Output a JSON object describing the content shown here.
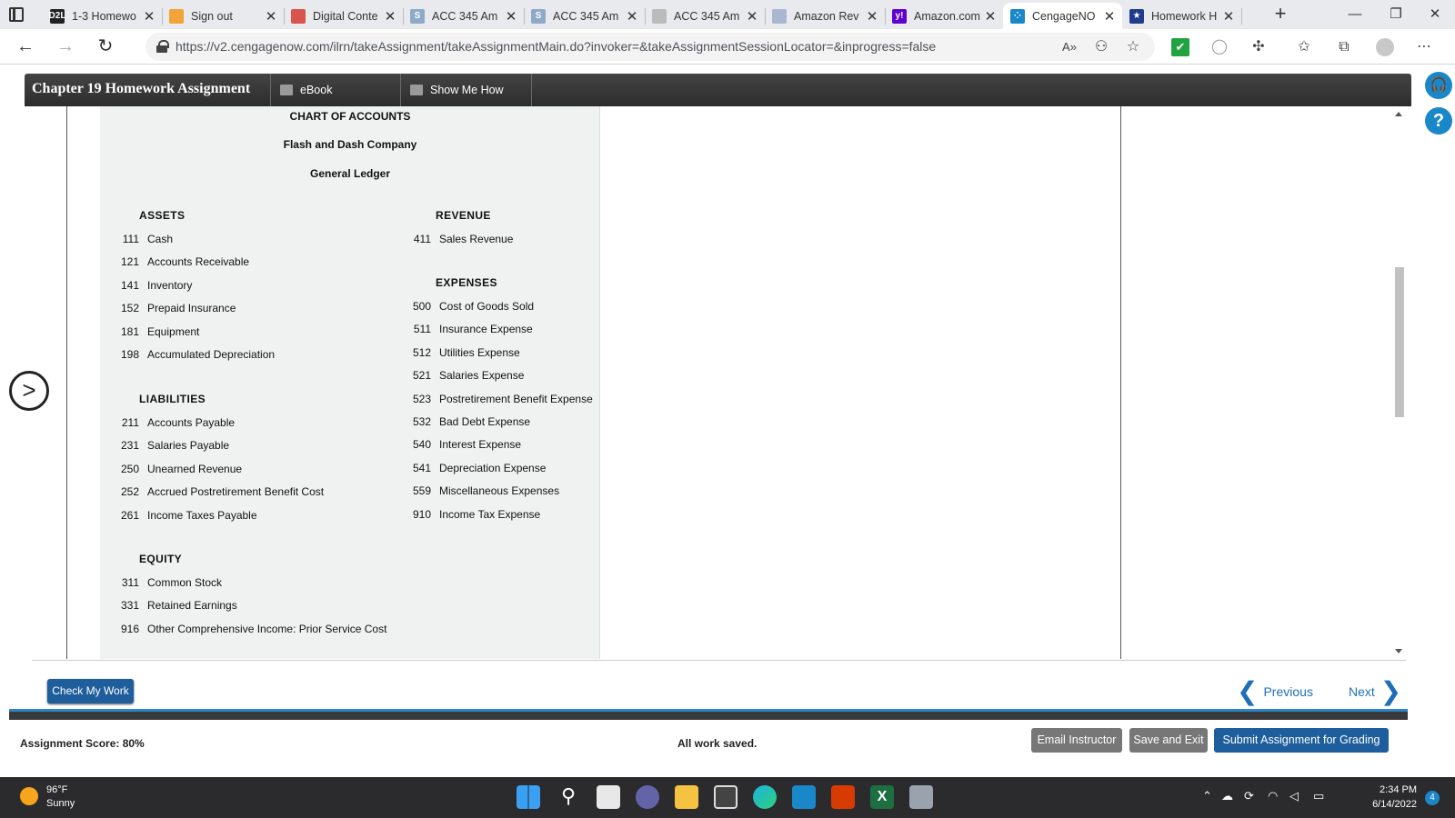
{
  "browser": {
    "tabs": [
      {
        "title": "1-3 Homewo",
        "favicon": "d2l-icon",
        "fav_color": "#222222",
        "fav_text": "D2L"
      },
      {
        "title": "Sign out",
        "favicon": "microsoft-icon",
        "fav_color": "#f2a33a",
        "fav_text": ""
      },
      {
        "title": "Digital Conte",
        "favicon": "book-icon",
        "fav_color": "#d9534f",
        "fav_text": ""
      },
      {
        "title": "ACC 345 Am",
        "favicon": "s-icon",
        "fav_color": "#8fa9c9",
        "fav_text": "S"
      },
      {
        "title": "ACC 345 Am",
        "favicon": "s-icon",
        "fav_color": "#8fa9c9",
        "fav_text": "S"
      },
      {
        "title": "ACC 345 Am",
        "favicon": "document-icon",
        "fav_color": "#bbbbbb",
        "fav_text": ""
      },
      {
        "title": "Amazon Rev",
        "favicon": "chart-icon",
        "fav_color": "#a9b7d0",
        "fav_text": ""
      },
      {
        "title": "Amazon.com",
        "favicon": "yahoo-icon",
        "fav_color": "#6001d2",
        "fav_text": "y!"
      },
      {
        "title": "CengageNO",
        "favicon": "loading-icon",
        "fav_color": "#1a87c9",
        "fav_text": "⁘"
      },
      {
        "title": "Homework H",
        "favicon": "star-badge-icon",
        "fav_color": "#1f3b8c",
        "fav_text": "★"
      }
    ],
    "new_tab_label": "+",
    "url": "https://v2.cengagenow.com/ilrn/takeAssignment/takeAssignmentMain.do?invoker=&takeAssignmentSessionLocator=&inprogress=false"
  },
  "app": {
    "title": "Chapter 19 Homework Assignment",
    "tabs": [
      {
        "label": "eBook"
      },
      {
        "label": "Show Me How"
      }
    ]
  },
  "coa": {
    "heading": "CHART OF ACCOUNTS",
    "company": "Flash and Dash Company",
    "ledger": "General Ledger",
    "assets_title": "ASSETS",
    "assets": [
      {
        "no": "111",
        "name": "Cash"
      },
      {
        "no": "121",
        "name": "Accounts Receivable"
      },
      {
        "no": "141",
        "name": "Inventory"
      },
      {
        "no": "152",
        "name": "Prepaid Insurance"
      },
      {
        "no": "181",
        "name": "Equipment"
      },
      {
        "no": "198",
        "name": "Accumulated Depreciation"
      }
    ],
    "liabilities_title": "LIABILITIES",
    "liabilities": [
      {
        "no": "211",
        "name": "Accounts Payable"
      },
      {
        "no": "231",
        "name": "Salaries Payable"
      },
      {
        "no": "250",
        "name": "Unearned Revenue"
      },
      {
        "no": "252",
        "name": "Accrued Postretirement Benefit Cost"
      },
      {
        "no": "261",
        "name": "Income Taxes Payable"
      }
    ],
    "equity_title": "EQUITY",
    "equity": [
      {
        "no": "311",
        "name": "Common Stock"
      },
      {
        "no": "331",
        "name": "Retained Earnings"
      },
      {
        "no": "916",
        "name": "Other Comprehensive Income: Prior Service Cost"
      }
    ],
    "revenue_title": "REVENUE",
    "revenue": [
      {
        "no": "411",
        "name": "Sales Revenue"
      }
    ],
    "expenses_title": "EXPENSES",
    "expenses": [
      {
        "no": "500",
        "name": "Cost of Goods Sold"
      },
      {
        "no": "511",
        "name": "Insurance Expense"
      },
      {
        "no": "512",
        "name": "Utilities Expense"
      },
      {
        "no": "521",
        "name": "Salaries Expense"
      },
      {
        "no": "523",
        "name": "Postretirement Benefit Expense"
      },
      {
        "no": "532",
        "name": "Bad Debt Expense"
      },
      {
        "no": "540",
        "name": "Interest Expense"
      },
      {
        "no": "541",
        "name": "Depreciation Expense"
      },
      {
        "no": "559",
        "name": "Miscellaneous Expenses"
      },
      {
        "no": "910",
        "name": "Income Tax Expense"
      }
    ]
  },
  "footer": {
    "check_label": "Check My Work",
    "previous_label": "Previous",
    "next_label": "Next"
  },
  "status": {
    "score": "Assignment Score: 80%",
    "saved": "All work saved.",
    "email_label": "Email Instructor",
    "save_exit_label": "Save and Exit",
    "submit_label": "Submit Assignment for Grading"
  },
  "taskbar": {
    "temperature": "96°F",
    "condition": "Sunny",
    "time": "2:34 PM",
    "date": "6/14/2022",
    "notifications": "4"
  },
  "colors": {
    "accent": "#1f5e9c",
    "link": "#1f6fb8",
    "header": "#333333",
    "grey_button": "#7a7a7a"
  }
}
